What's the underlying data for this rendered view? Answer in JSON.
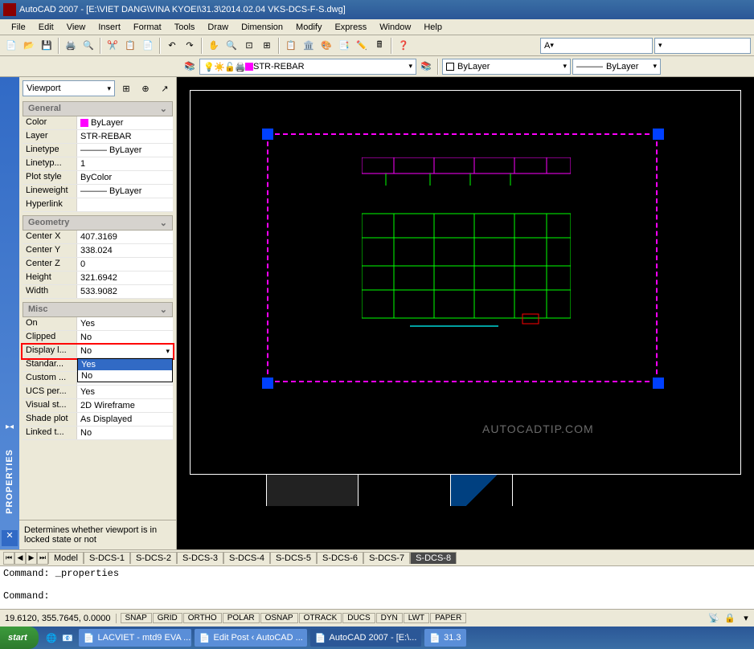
{
  "title": "AutoCAD 2007 - [E:\\VIET DANG\\VINA KYOEI\\31.3\\2014.02.04 VKS-DCS-F-S.dwg]",
  "menu": [
    "File",
    "Edit",
    "View",
    "Insert",
    "Format",
    "Tools",
    "Draw",
    "Dimension",
    "Modify",
    "Express",
    "Window",
    "Help"
  ],
  "layer_current": "STR-REBAR",
  "linecolor": "ByLayer",
  "linetype_label": "ByLayer",
  "side_label": "PROPERTIES",
  "prop_object": "Viewport",
  "sections": {
    "general": {
      "title": "General",
      "rows": [
        {
          "label": "Color",
          "value": "ByLayer",
          "swatch": "#ff00ff"
        },
        {
          "label": "Layer",
          "value": "STR-REBAR"
        },
        {
          "label": "Linetype",
          "value": "——— ByLayer"
        },
        {
          "label": "Linetyp...",
          "value": "1"
        },
        {
          "label": "Plot style",
          "value": "ByColor"
        },
        {
          "label": "Lineweight",
          "value": "——— ByLayer"
        },
        {
          "label": "Hyperlink",
          "value": ""
        }
      ]
    },
    "geometry": {
      "title": "Geometry",
      "rows": [
        {
          "label": "Center X",
          "value": "407.3169"
        },
        {
          "label": "Center Y",
          "value": "338.024"
        },
        {
          "label": "Center Z",
          "value": "0"
        },
        {
          "label": "Height",
          "value": "321.6942"
        },
        {
          "label": "Width",
          "value": "533.9082"
        }
      ]
    },
    "misc": {
      "title": "Misc",
      "rows": [
        {
          "label": "On",
          "value": "Yes"
        },
        {
          "label": "Clipped",
          "value": "No"
        },
        {
          "label": "Display l...",
          "value": "No",
          "highlighted": true,
          "dropdown": true
        },
        {
          "label": "Standar...",
          "value": "Yes"
        },
        {
          "label": "Custom ...",
          "value": "No"
        },
        {
          "label": "UCS per...",
          "value": "Yes"
        },
        {
          "label": "Visual st...",
          "value": "2D Wireframe"
        },
        {
          "label": "Shade plot",
          "value": "As Displayed"
        },
        {
          "label": "Linked t...",
          "value": "No"
        }
      ],
      "dropdown_options": [
        "Yes",
        "No"
      ]
    }
  },
  "hint": "Determines whether viewport is in locked state or not",
  "tabs": [
    "Model",
    "S-DCS-1",
    "S-DCS-2",
    "S-DCS-3",
    "S-DCS-4",
    "S-DCS-5",
    "S-DCS-6",
    "S-DCS-7",
    "S-DCS-8"
  ],
  "active_tab": "S-DCS-8",
  "command_lines": [
    "Command: _properties",
    "",
    "Command:"
  ],
  "coords": "19.6120, 355.7645, 0.0000",
  "status_toggles": [
    "SNAP",
    "GRID",
    "ORTHO",
    "POLAR",
    "OSNAP",
    "OTRACK",
    "DUCS",
    "DYN",
    "LWT",
    "PAPER"
  ],
  "watermark": "AUTOCADTIP.COM",
  "taskbar": {
    "start": "start",
    "items": [
      {
        "label": "LACVIET - mtd9 EVA ..."
      },
      {
        "label": "Edit Post ‹ AutoCAD ..."
      },
      {
        "label": "AutoCAD 2007 - [E:\\...",
        "active": true
      },
      {
        "label": "31.3"
      }
    ]
  }
}
